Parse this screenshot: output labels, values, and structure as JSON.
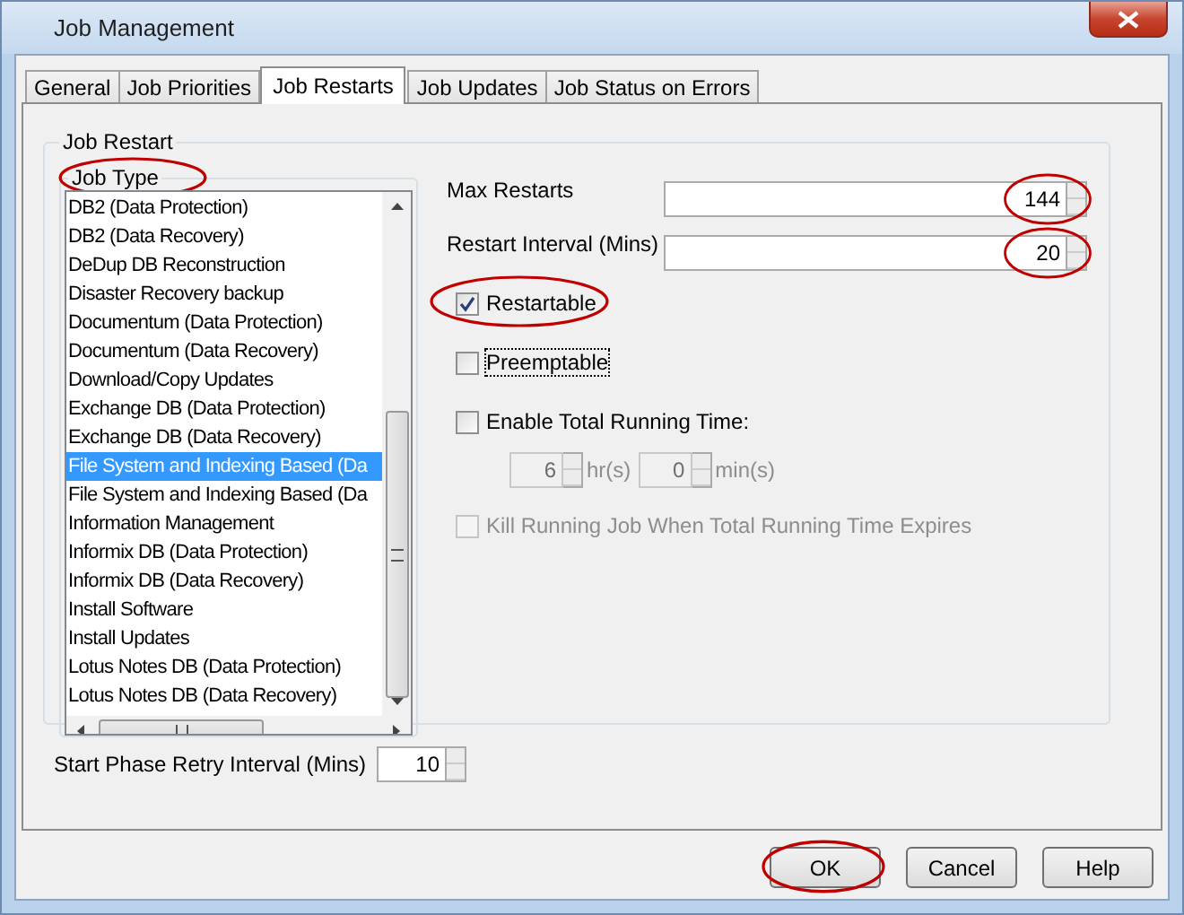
{
  "window": {
    "title": "Job Management"
  },
  "tabs": [
    {
      "label": "General",
      "selected": false
    },
    {
      "label": "Job Priorities",
      "selected": false
    },
    {
      "label": "Job Restarts",
      "selected": true
    },
    {
      "label": "Job Updates",
      "selected": false
    },
    {
      "label": "Job Status on Errors",
      "selected": false
    }
  ],
  "group": {
    "title": "Job Restart"
  },
  "job_type": {
    "title": "Job Type",
    "circled": true,
    "items": [
      {
        "label": "DB2 (Data Protection)",
        "selected": false
      },
      {
        "label": "DB2 (Data Recovery)",
        "selected": false
      },
      {
        "label": "DeDup DB Reconstruction",
        "selected": false
      },
      {
        "label": "Disaster Recovery backup",
        "selected": false
      },
      {
        "label": "Documentum (Data Protection)",
        "selected": false
      },
      {
        "label": "Documentum (Data Recovery)",
        "selected": false
      },
      {
        "label": "Download/Copy Updates",
        "selected": false
      },
      {
        "label": "Exchange DB (Data Protection)",
        "selected": false
      },
      {
        "label": "Exchange DB (Data Recovery)",
        "selected": false
      },
      {
        "label": "File System and Indexing Based (Da",
        "selected": true
      },
      {
        "label": "File System and Indexing Based (Da",
        "selected": false
      },
      {
        "label": "Information Management",
        "selected": false
      },
      {
        "label": "Informix DB (Data Protection)",
        "selected": false
      },
      {
        "label": "Informix DB (Data Recovery)",
        "selected": false
      },
      {
        "label": "Install Software",
        "selected": false
      },
      {
        "label": "Install Updates",
        "selected": false
      },
      {
        "label": "Lotus Notes DB (Data Protection)",
        "selected": false
      },
      {
        "label": "Lotus Notes DB (Data Recovery)",
        "selected": false
      }
    ]
  },
  "fields": [
    {
      "label": "Max Restarts",
      "value": "144",
      "circled": true
    },
    {
      "label": "Restart Interval (Mins)",
      "value": "20",
      "circled": true
    }
  ],
  "options": [
    {
      "label": "Restartable",
      "checked": true,
      "disabled": false,
      "focused": false,
      "circled": true
    },
    {
      "label": "Preemptable",
      "checked": false,
      "disabled": false,
      "focused": true,
      "circled": false
    },
    {
      "label": "Enable Total Running Time:",
      "checked": false,
      "disabled": false,
      "focused": false,
      "circled": false
    }
  ],
  "running_time": {
    "disabled": true,
    "hours": "6",
    "hours_unit": "hr(s)",
    "minutes": "0",
    "minutes_unit": "min(s)"
  },
  "kill_option": {
    "label": "Kill Running Job When Total Running Time Expires",
    "checked": false,
    "disabled": true
  },
  "retry": {
    "label": "Start Phase Retry Interval (Mins)",
    "value": "10"
  },
  "buttons": [
    {
      "label": "OK",
      "circled": true
    },
    {
      "label": "Cancel",
      "circled": false
    },
    {
      "label": "Help",
      "circled": false
    }
  ]
}
